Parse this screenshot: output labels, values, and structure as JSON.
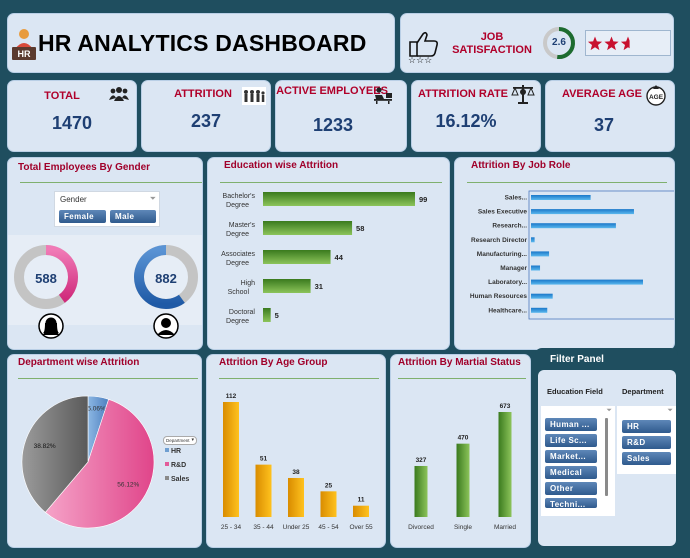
{
  "header": {
    "title": "HR ANALYTICS DASHBOARD",
    "logo_text": "HR"
  },
  "job_satisfaction": {
    "label": "JOB SATISFACTION",
    "score": "2.6",
    "stars_filled": 2.6,
    "stars_total": 5,
    "gauge_fraction": 0.52
  },
  "kpis": [
    {
      "label": "TOTAL",
      "value": "1470",
      "icon": "group-icon"
    },
    {
      "label": "ATTRITION",
      "value": "237",
      "icon": "queue-icon"
    },
    {
      "label": "ACTIVE EMPLOYEES",
      "value": "1233",
      "icon": "desk-worker-icon"
    },
    {
      "label": "ATTRITION RATE",
      "value": "16.12%",
      "icon": "scale-icon"
    },
    {
      "label": "AVERAGE AGE",
      "value": "37",
      "icon": "age-icon"
    }
  ],
  "gender": {
    "title": "Total Employees By Gender",
    "slicer_title": "Gender",
    "buttons": [
      "Female",
      "Male"
    ],
    "female": "588",
    "male": "882",
    "female_fraction": 0.4,
    "male_fraction": 0.6
  },
  "filter_panel": {
    "title": "Filter Panel",
    "education_label": "Education Field",
    "department_label": "Department",
    "education_items": [
      "Human ...",
      "Life Sc...",
      "Market...",
      "Medical",
      "Other",
      "Techni..."
    ],
    "department_items": [
      "HR",
      "R&D",
      "Sales"
    ]
  },
  "pie_legend_header": "Department",
  "chart_data": [
    {
      "type": "bar",
      "title": "Education wise Attrition",
      "categories": [
        "Bachelor's Degree",
        "Master's Degree",
        "Associates Degree",
        "High School",
        "Doctoral Degree"
      ],
      "values": [
        99,
        58,
        44,
        31,
        5
      ],
      "orientation": "horizontal",
      "colors": [
        "#3a7a1e",
        "#8cc45a"
      ]
    },
    {
      "type": "bar",
      "title": "Attrition By Job Role",
      "categories": [
        "Sales...",
        "Sales Executive",
        "Research...",
        "Research Director",
        "Manufacturing...",
        "Manager",
        "Laboratory...",
        "Human Resources",
        "Healthcare..."
      ],
      "values": [
        33,
        57,
        47,
        2,
        10,
        5,
        62,
        12,
        9
      ],
      "orientation": "horizontal",
      "colors": [
        "#1a77c9",
        "#5ab8ee"
      ]
    },
    {
      "type": "pie",
      "title": "Department wise Attrition",
      "categories": [
        "HR",
        "R&D",
        "Sales"
      ],
      "labels": [
        "5.06%",
        "56.12%",
        "38.82%"
      ],
      "values": [
        5.06,
        56.12,
        38.82
      ],
      "colors": [
        "#6f9fd1",
        "#e35b9a",
        "#6f6f6f"
      ],
      "legend": "right"
    },
    {
      "type": "bar",
      "title": "Attrition By Age Group",
      "categories": [
        "25 - 34",
        "35 - 44",
        "Under 25",
        "45 - 54",
        "Over 55"
      ],
      "values": [
        112,
        51,
        38,
        25,
        11
      ],
      "colors": [
        "#d98c00",
        "#ffc21e"
      ]
    },
    {
      "type": "bar",
      "title": "Attrition By Martial Status",
      "categories": [
        "Divorced",
        "Single",
        "Married"
      ],
      "values": [
        327,
        470,
        673
      ],
      "colors": [
        "#3a7a1e",
        "#8cc45a"
      ]
    }
  ]
}
